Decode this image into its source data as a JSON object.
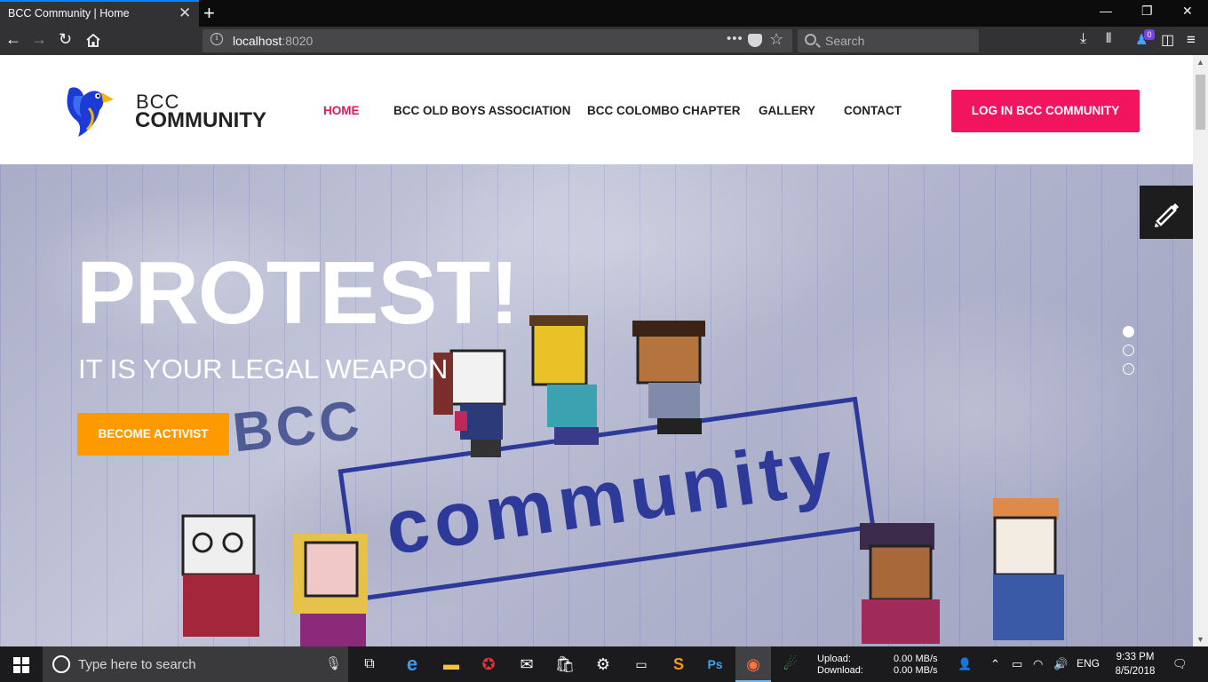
{
  "browser": {
    "tab_title": "BCC Community | Home",
    "tab_close": "✕",
    "new_tab": "+",
    "window_controls": {
      "minimize": "—",
      "restore": "❐",
      "close": "✕"
    },
    "url_host": "localhost",
    "url_port": ":8020",
    "url_more": "•••",
    "search_placeholder": "Search",
    "library_badge": "0"
  },
  "site": {
    "brand_top": "BCC",
    "brand_bottom": "COMMUNITY",
    "nav": [
      {
        "label": "HOME",
        "active": true
      },
      {
        "label": "BCC OLD BOYS ASSOCIATION",
        "active": false
      },
      {
        "label": "BCC COLOMBO CHAPTER",
        "active": false
      },
      {
        "label": "GALLERY",
        "active": false
      },
      {
        "label": "CONTACT",
        "active": false
      }
    ],
    "login_label": "LOG IN BCC COMMUNITY",
    "accent_color": "#f2145f",
    "cta_color": "#fd9a00"
  },
  "hero": {
    "title": "PROTEST!",
    "subtitle": "IT IS YOUR LEGAL WEAPON",
    "cta_label": "BECOME ACTIVIST",
    "art_text_bcc": "BCC",
    "art_text_stamp": "community",
    "slides": 3,
    "active_slide": 1
  },
  "taskbar": {
    "search_placeholder": "Type here to search",
    "upload_label": "Upload:",
    "download_label": "Download:",
    "upload_rate": "0.00 MB/s",
    "download_rate": "0.00 MB/s",
    "language": "ENG",
    "time": "9:33 PM",
    "date": "8/5/2018"
  }
}
